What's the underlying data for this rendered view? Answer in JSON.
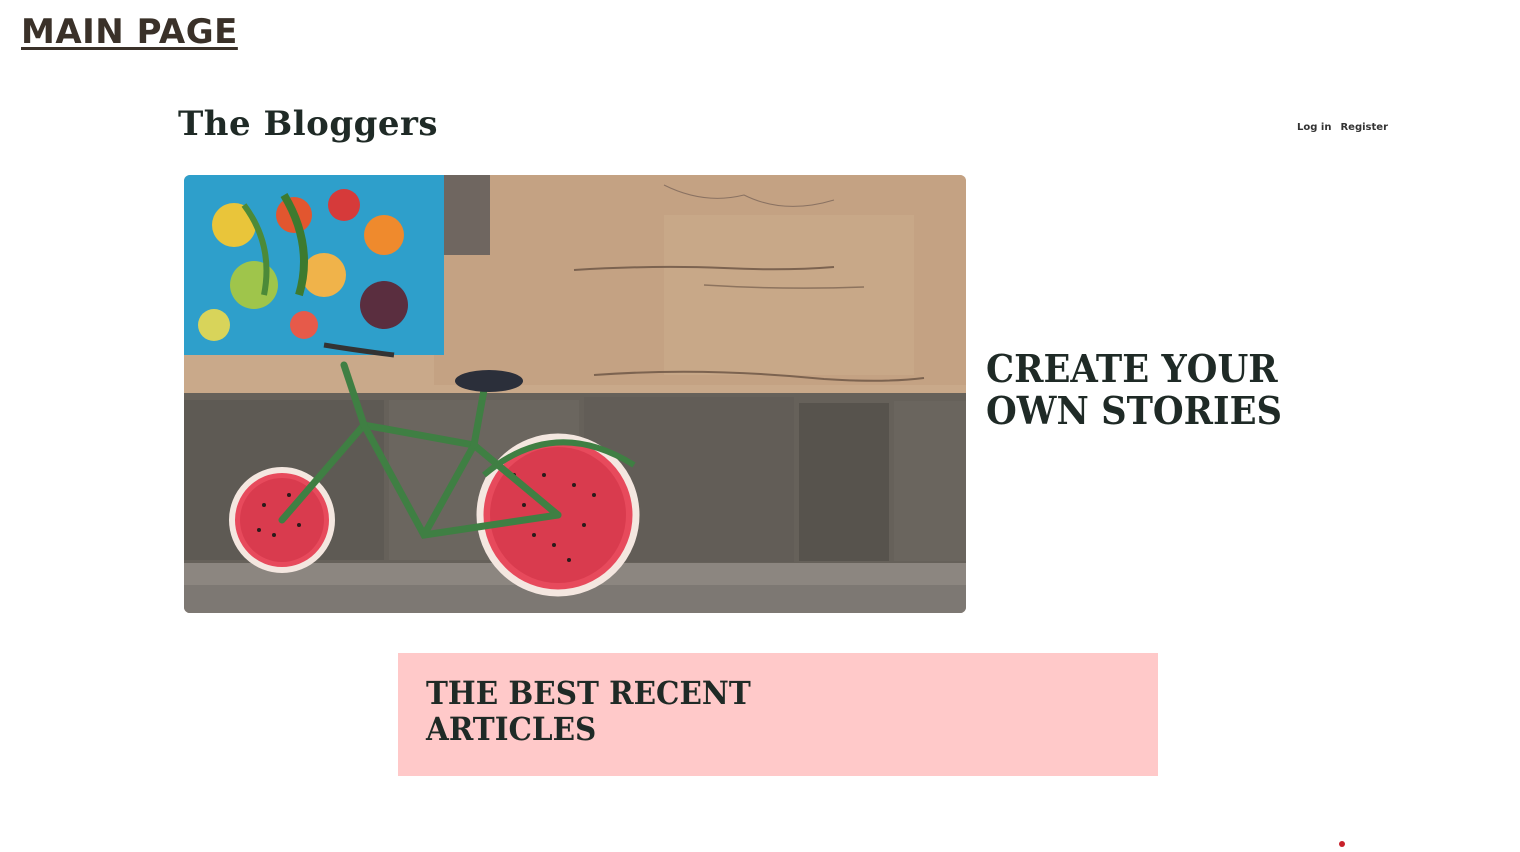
{
  "page_label": "MAIN PAGE",
  "header": {
    "site_title": "The Bloggers",
    "login_label": "Log in",
    "register_label": "Register"
  },
  "hero": {
    "heading": "CREATE YOUR OWN STORIES"
  },
  "articles": {
    "heading": "THE BEST RECENT ARTICLES"
  },
  "colors": {
    "banner_background": "#ffc9c9",
    "heading_text": "#1f2a26",
    "indicator_dot": "#c8202a"
  }
}
